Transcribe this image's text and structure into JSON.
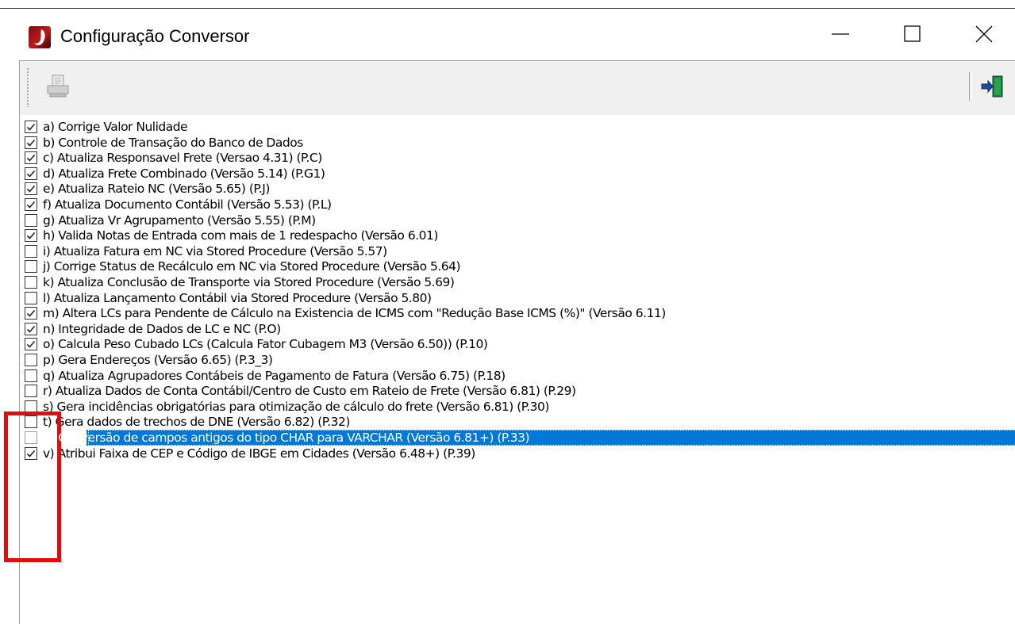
{
  "window": {
    "title": "Configuração Conversor",
    "controls": {
      "minimize": "minimize-icon",
      "maximize": "maximize-icon",
      "close": "close-icon"
    }
  },
  "toolbar": {
    "left_button_icon": "printer-icon",
    "right_button_icon": "exit-door-icon"
  },
  "colors": {
    "selection": "#0078d7",
    "annotation_box": "#e30b0b"
  },
  "items": [
    {
      "label": "a) Corrige Valor Nulidade",
      "checked": true
    },
    {
      "label": "b) Controle de Transação do Banco de Dados",
      "checked": true
    },
    {
      "label": "c) Atualiza Responsavel Frete (Versao 4.31) (P.C)",
      "checked": true
    },
    {
      "label": "d) Atualiza Frete Combinado (Versão 5.14) (P.G1)",
      "checked": true
    },
    {
      "label": "e) Atualiza Rateio NC (Versão 5.65) (P.J)",
      "checked": true
    },
    {
      "label": "f) Atualiza Documento Contábil (Versão 5.53) (P.L)",
      "checked": true
    },
    {
      "label": "g) Atualiza Vr Agrupamento (Versão 5.55) (P.M)",
      "checked": false
    },
    {
      "label": "h) Valida Notas de Entrada com mais de 1 redespacho (Versão 6.01)",
      "checked": true
    },
    {
      "label": "i) Atualiza Fatura em NC via Stored Procedure (Versão 5.57)",
      "checked": false
    },
    {
      "label": "j) Corrige Status de Recálculo em NC via Stored Procedure (Versão 5.64)",
      "checked": false
    },
    {
      "label": "k) Atualiza Conclusão de Transporte via Stored Procedure (Versão 5.69)",
      "checked": false
    },
    {
      "label": "l) Atualiza Lançamento Contábil via Stored Procedure (Versão 5.80)",
      "checked": false
    },
    {
      "label": "m) Altera LCs para Pendente de Cálculo na Existencia de ICMS com \"Redução Base ICMS (%)\" (Versão 6.11)",
      "checked": true
    },
    {
      "label": "n) Integridade de Dados de LC e NC (P.O)",
      "checked": true
    },
    {
      "label": "o) Calcula Peso Cubado LCs (Calcula Fator Cubagem M3 (Versão 6.50)) (P.10)",
      "checked": true
    },
    {
      "label": "p) Gera Endereços (Versão 6.65) (P.3_3)",
      "checked": false
    },
    {
      "label": "q) Atualiza Agrupadores Contábeis de Pagamento de Fatura (Versão 6.75) (P.18)",
      "checked": false
    },
    {
      "label": "r) Atualiza Dados de Conta Contábil/Centro de Custo em Rateio de Frete (Versão 6.81) (P.29)",
      "checked": false
    },
    {
      "label": "s) Gera incidências obrigatórias para otimização de cálculo do frete (Versão 6.81) (P.30)",
      "checked": false
    },
    {
      "label": "t) Gera dados de trechos de DNE (Versão 6.82) (P.32)",
      "checked": false
    },
    {
      "label": "u) Conversão de campos antigos do tipo CHAR para VARCHAR (Versão 6.81+) (P.33)",
      "checked": false,
      "selected": true
    },
    {
      "label": "v) Atribui Faixa de CEP e Código de IBGE em Cidades (Versão 6.48+) (P.39)",
      "checked": true
    }
  ]
}
